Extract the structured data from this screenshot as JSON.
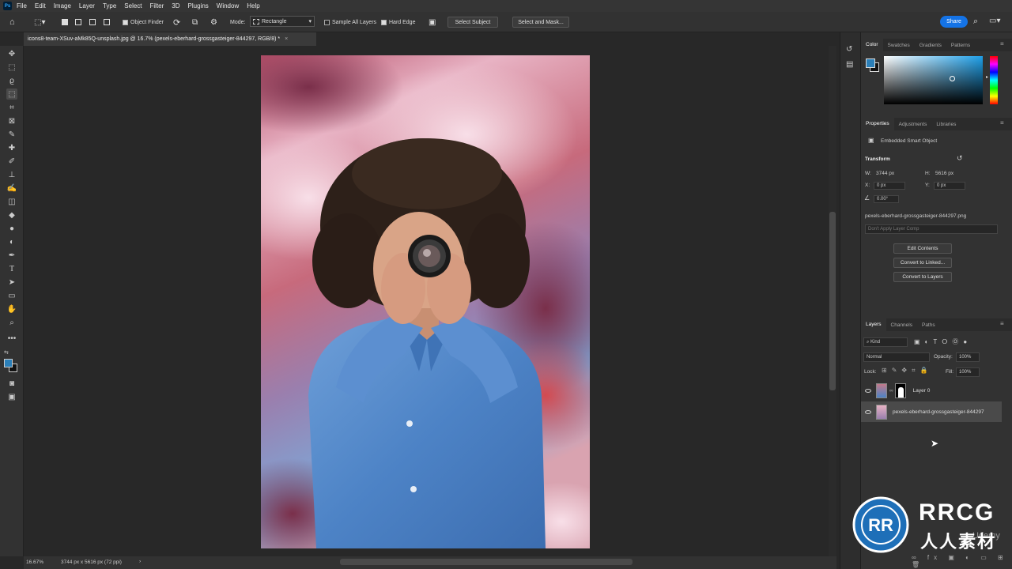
{
  "app": {
    "logo": "Ps"
  },
  "menu": [
    "File",
    "Edit",
    "Image",
    "Layer",
    "Type",
    "Select",
    "Filter",
    "3D",
    "Plugins",
    "Window",
    "Help"
  ],
  "options": {
    "object_finder": "Object Finder",
    "mode_label": "Mode:",
    "mode_value": "Rectangle",
    "sample_all_layers": "Sample All Layers",
    "hard_edge": "Hard Edge",
    "select_subject": "Select Subject",
    "select_and_mask": "Select and Mask...",
    "share": "Share"
  },
  "document": {
    "tab_title": "icons8-team-XSuv-aMk85Q-unsplash.jpg @ 16.7% (pexels-eberhard-grossgasteiger-844297, RGB/8) *",
    "tab_close": "×"
  },
  "status": {
    "zoom": "16.67%",
    "dimensions": "3744 px x 5616 px (72 ppi)",
    "arrow": "›"
  },
  "color_panel": {
    "tabs": [
      "Color",
      "Swatches",
      "Gradients",
      "Patterns"
    ],
    "foreground": "#2b7fb8",
    "background": "#111111"
  },
  "properties": {
    "tabs": [
      "Properties",
      "Adjustments",
      "Libraries"
    ],
    "type": "Embedded Smart Object",
    "transform_label": "Transform",
    "w_label": "W:",
    "w_value": "3744 px",
    "h_label": "H:",
    "h_value": "5616 px",
    "x_label": "X:",
    "x_value": "0 px",
    "y_label": "Y:",
    "y_value": "0 px",
    "angle_value": "0.00°",
    "filename": "pexels-eberhard-grossgasteiger-844297.png",
    "layer_comp_placeholder": "Don't Apply Layer Comp",
    "edit_contents": "Edit Contents",
    "convert_linked": "Convert to Linked...",
    "convert_layers": "Convert to Layers"
  },
  "layers_panel": {
    "tabs": [
      "Layers",
      "Channels",
      "Paths"
    ],
    "kind": "Kind",
    "blend_mode": "Normal",
    "opacity_label": "Opacity:",
    "opacity_value": "100%",
    "lock_label": "Lock:",
    "fill_label": "Fill:",
    "fill_value": "100%",
    "layers": [
      {
        "name": "Layer 0"
      },
      {
        "name": "pexels-eberhard-grossgasteiger-844297"
      }
    ]
  },
  "watermark": {
    "brand": "RRCG",
    "subtitle": "人人素材",
    "logo_letters": "RR",
    "ghost": "Udemy"
  }
}
